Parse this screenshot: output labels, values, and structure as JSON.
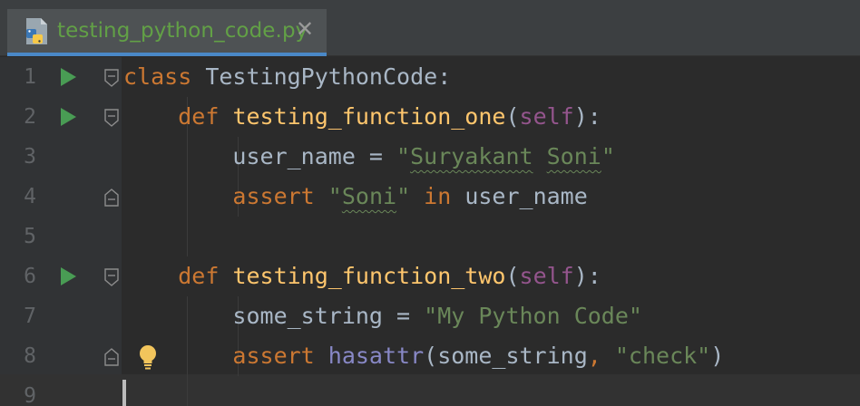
{
  "tab": {
    "filename": "testing_python_code.py",
    "file_icon": "python-file-icon",
    "close_icon": "close-icon",
    "close_symbol": "✕",
    "active_color": "#4a88c7",
    "label_color": "#62a046"
  },
  "editor": {
    "lines": [
      {
        "num": "1",
        "run": true,
        "fold": "open",
        "tokens": [
          {
            "t": "class ",
            "c": "kw"
          },
          {
            "t": "TestingPythonCode",
            "c": "cls"
          },
          {
            "t": ":",
            "c": "cls"
          }
        ]
      },
      {
        "num": "2",
        "run": true,
        "fold": "open",
        "tokens": [
          {
            "t": "    "
          },
          {
            "t": "def ",
            "c": "kw"
          },
          {
            "t": "testing_function_one",
            "c": "fn"
          },
          {
            "t": "("
          },
          {
            "t": "self",
            "c": "self"
          },
          {
            "t": "):"
          }
        ]
      },
      {
        "num": "3",
        "tokens": [
          {
            "t": "        user_name = "
          },
          {
            "t": "\"",
            "c": "str"
          },
          {
            "t": "Suryakant",
            "c": "str typo"
          },
          {
            "t": " ",
            "c": "str"
          },
          {
            "t": "Soni",
            "c": "str typo"
          },
          {
            "t": "\"",
            "c": "str"
          }
        ]
      },
      {
        "num": "4",
        "fold": "close",
        "tokens": [
          {
            "t": "        "
          },
          {
            "t": "assert ",
            "c": "kw"
          },
          {
            "t": "\"",
            "c": "str"
          },
          {
            "t": "Soni",
            "c": "str typo"
          },
          {
            "t": "\" ",
            "c": "str"
          },
          {
            "t": "in ",
            "c": "kw"
          },
          {
            "t": "user_name"
          }
        ]
      },
      {
        "num": "5",
        "tokens": []
      },
      {
        "num": "6",
        "run": true,
        "fold": "open",
        "tokens": [
          {
            "t": "    "
          },
          {
            "t": "def ",
            "c": "kw"
          },
          {
            "t": "testing_function_two",
            "c": "fn"
          },
          {
            "t": "("
          },
          {
            "t": "self",
            "c": "self"
          },
          {
            "t": "):"
          }
        ]
      },
      {
        "num": "7",
        "tokens": [
          {
            "t": "        some_string = "
          },
          {
            "t": "\"My Python Code\"",
            "c": "str"
          }
        ]
      },
      {
        "num": "8",
        "fold": "close",
        "bulb": true,
        "tokens": [
          {
            "t": "        "
          },
          {
            "t": "assert ",
            "c": "kw"
          },
          {
            "t": "hasattr",
            "c": "bi"
          },
          {
            "t": "(some_string"
          },
          {
            "t": ", ",
            "c": "kw"
          },
          {
            "t": "\"check\"",
            "c": "str"
          },
          {
            "t": ")"
          }
        ]
      },
      {
        "num": "9",
        "tokens": []
      }
    ],
    "icons": {
      "run": "run-test-icon",
      "fold_open": "fold-open-icon",
      "fold_close": "fold-close-icon",
      "bulb": "intention-bulb-icon"
    },
    "colors": {
      "background": "#2b2b2b",
      "gutter": "#313335",
      "keyword": "#cc7832",
      "function": "#ffc66d",
      "self": "#94558d",
      "string": "#6a8759",
      "builtin": "#8888c6",
      "text": "#a9b7c6",
      "line_number": "#606366",
      "run": "#499c54"
    }
  }
}
